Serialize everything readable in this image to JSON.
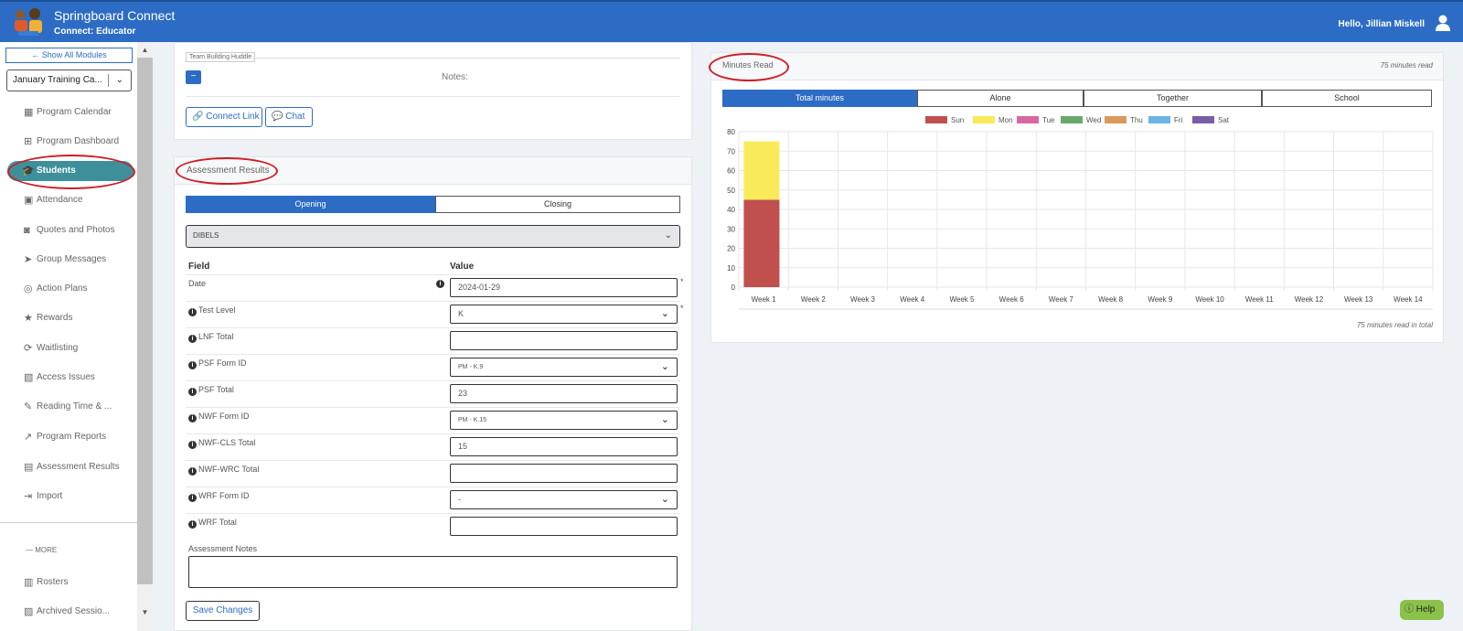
{
  "header": {
    "brand": "Springboard Connect",
    "subtitle": "Connect: Educator",
    "greeting": "Hello, Jillian Miskell"
  },
  "sidebar": {
    "show_all": "← Show All Modules",
    "program_select": "January Training Ca...",
    "items": [
      {
        "label": "Program Calendar",
        "icon": "calendar-icon"
      },
      {
        "label": "Program Dashboard",
        "icon": "dashboard-icon"
      },
      {
        "label": "Students",
        "icon": "graduation-cap-icon",
        "active": true
      },
      {
        "label": "Attendance",
        "icon": "person-badge-icon"
      },
      {
        "label": "Quotes and Photos",
        "icon": "camera-icon"
      },
      {
        "label": "Group Messages",
        "icon": "send-icon"
      },
      {
        "label": "Action Plans",
        "icon": "target-icon"
      },
      {
        "label": "Rewards",
        "icon": "star-icon"
      },
      {
        "label": "Waitlisting",
        "icon": "refresh-icon"
      },
      {
        "label": "Access Issues",
        "icon": "image-off-icon"
      },
      {
        "label": "Reading Time & ...",
        "icon": "edit-icon"
      },
      {
        "label": "Program Reports",
        "icon": "trending-icon"
      },
      {
        "label": "Assessment Results",
        "icon": "book-icon"
      },
      {
        "label": "Import",
        "icon": "import-icon"
      }
    ],
    "more": "— MORE",
    "bottom_items": [
      {
        "label": "Rosters",
        "icon": "roster-icon"
      },
      {
        "label": "Archived Sessio...",
        "icon": "archive-icon"
      }
    ]
  },
  "top_card": {
    "legend": "Team Building Huddle",
    "minus": "−",
    "notes_label": "Notes:",
    "connect_link": "Connect Link",
    "chat": "Chat"
  },
  "assessment": {
    "title": "Assessment Results",
    "tabs": [
      "Opening",
      "Closing"
    ],
    "test_select": "DIBELS",
    "col_field": "Field",
    "col_value": "Value",
    "fields": [
      {
        "label": "Date",
        "value": "2024-01-29",
        "type": "text",
        "required": true
      },
      {
        "label": "Test Level",
        "value": "K",
        "type": "select",
        "required": true
      },
      {
        "label": "LNF Total",
        "value": "",
        "type": "text"
      },
      {
        "label": "PSF Form ID",
        "value": "PM - K.9",
        "type": "select"
      },
      {
        "label": "PSF Total",
        "value": "23",
        "type": "text"
      },
      {
        "label": "NWF Form ID",
        "value": "PM - K.15",
        "type": "select"
      },
      {
        "label": "NWF-CLS Total",
        "value": "15",
        "type": "text"
      },
      {
        "label": "NWF-WRC Total",
        "value": "",
        "type": "text"
      },
      {
        "label": "WRF Form ID",
        "value": "-",
        "type": "select"
      },
      {
        "label": "WRF Total",
        "value": "",
        "type": "text"
      }
    ],
    "notes_label": "Assessment Notes",
    "save": "Save Changes"
  },
  "minutes": {
    "title": "Minutes Read",
    "summary": "75 minutes read",
    "footer": "75 minutes read in total",
    "tabs": [
      "Total minutes",
      "Alone",
      "Together",
      "School"
    ]
  },
  "chart_data": {
    "type": "bar",
    "stacked": true,
    "categories": [
      "Week 1",
      "Week 2",
      "Week 3",
      "Week 4",
      "Week 5",
      "Week 6",
      "Week 7",
      "Week 8",
      "Week 9",
      "Week 10",
      "Week 11",
      "Week 12",
      "Week 13",
      "Week 14"
    ],
    "series": [
      {
        "name": "Sun",
        "color": "#c0504d",
        "values": [
          45,
          0,
          0,
          0,
          0,
          0,
          0,
          0,
          0,
          0,
          0,
          0,
          0,
          0
        ]
      },
      {
        "name": "Mon",
        "color": "#f9ea5a",
        "values": [
          30,
          0,
          0,
          0,
          0,
          0,
          0,
          0,
          0,
          0,
          0,
          0,
          0,
          0
        ]
      },
      {
        "name": "Tue",
        "color": "#d966a3",
        "values": [
          0,
          0,
          0,
          0,
          0,
          0,
          0,
          0,
          0,
          0,
          0,
          0,
          0,
          0
        ]
      },
      {
        "name": "Wed",
        "color": "#6aa86b",
        "values": [
          0,
          0,
          0,
          0,
          0,
          0,
          0,
          0,
          0,
          0,
          0,
          0,
          0,
          0
        ]
      },
      {
        "name": "Thu",
        "color": "#d99a5a",
        "values": [
          0,
          0,
          0,
          0,
          0,
          0,
          0,
          0,
          0,
          0,
          0,
          0,
          0,
          0
        ]
      },
      {
        "name": "Fri",
        "color": "#6cb4e4",
        "values": [
          0,
          0,
          0,
          0,
          0,
          0,
          0,
          0,
          0,
          0,
          0,
          0,
          0,
          0
        ]
      },
      {
        "name": "Sat",
        "color": "#7a5ca8",
        "values": [
          0,
          0,
          0,
          0,
          0,
          0,
          0,
          0,
          0,
          0,
          0,
          0,
          0,
          0
        ]
      }
    ],
    "yticks": [
      0,
      10,
      20,
      30,
      40,
      50,
      60,
      70,
      80
    ],
    "ylim": [
      0,
      80
    ],
    "grid": true,
    "legend": "top"
  },
  "help": "Help"
}
